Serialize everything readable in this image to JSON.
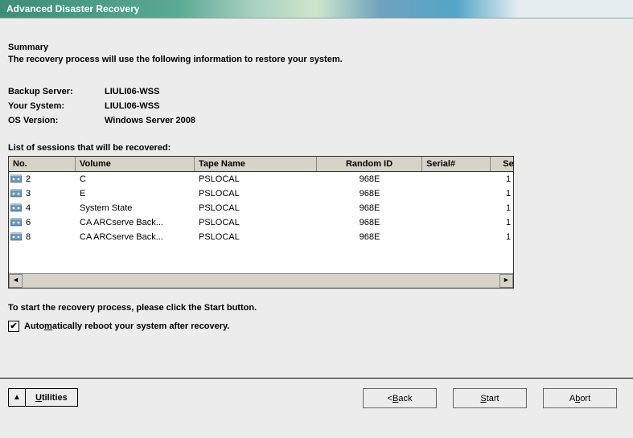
{
  "title": "Advanced Disaster Recovery",
  "summary": {
    "heading": "Summary",
    "text": "The recovery process will use the following information to restore your system."
  },
  "info": {
    "backup_server_label": "Backup Server:",
    "backup_server_value": "LIULI06-WSS",
    "your_system_label": "Your System:",
    "your_system_value": "LIULI06-WSS",
    "os_version_label": "OS Version:",
    "os_version_value": "Windows Server 2008"
  },
  "sessions": {
    "heading": "List of sessions that will be recovered:",
    "columns": {
      "no": "No.",
      "volume": "Volume",
      "tape": "Tape Name",
      "random": "Random ID",
      "serial": "Serial#",
      "se": "Se"
    },
    "rows": [
      {
        "no": "2",
        "volume": "C",
        "tape": "PSLOCAL",
        "random": "968E",
        "serial": "",
        "se": "1"
      },
      {
        "no": "3",
        "volume": "E",
        "tape": "PSLOCAL",
        "random": "968E",
        "serial": "",
        "se": "1"
      },
      {
        "no": "4",
        "volume": "System State",
        "tape": "PSLOCAL",
        "random": "968E",
        "serial": "",
        "se": "1"
      },
      {
        "no": "6",
        "volume": "CA ARCserve Back...",
        "tape": "PSLOCAL",
        "random": "968E",
        "serial": "",
        "se": "1"
      },
      {
        "no": "8",
        "volume": "CA ARCserve Back...",
        "tape": "PSLOCAL",
        "random": "968E",
        "serial": "",
        "se": "1"
      }
    ]
  },
  "recover_text": "To start the recovery process, please click the Start button.",
  "checkbox": {
    "checked": true,
    "pre": "Auto",
    "u": "m",
    "post": "atically reboot your system after recovery."
  },
  "footer": {
    "utilities_u": "U",
    "utilities_rest": "tilities",
    "back_lt": "< ",
    "back_u": "B",
    "back_rest": "ack",
    "start_u": "S",
    "start_rest": "tart",
    "abort_pre": "A",
    "abort_u": "b",
    "abort_rest": "ort"
  }
}
